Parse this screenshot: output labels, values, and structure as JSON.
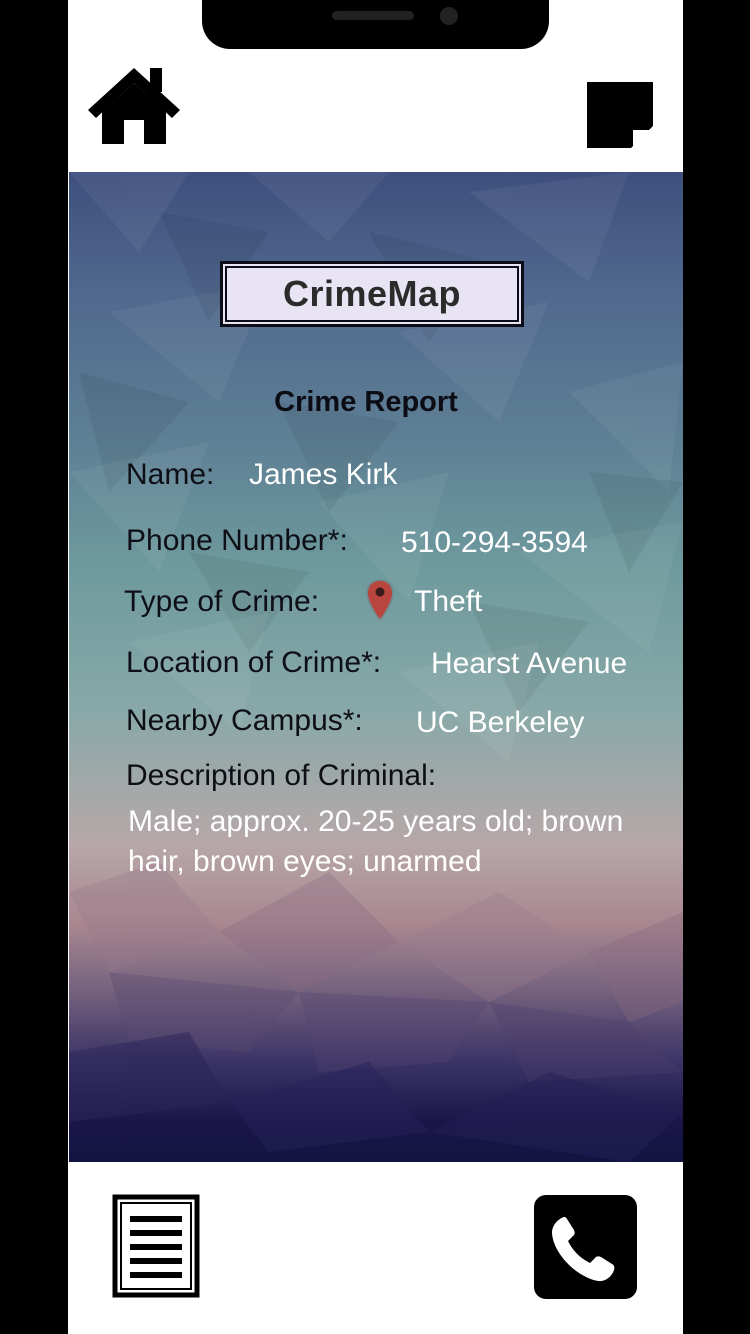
{
  "header": {
    "home_icon": "home-icon",
    "note_icon": "note-icon"
  },
  "app": {
    "title": "CrimeMap"
  },
  "report": {
    "title": "Crime Report",
    "fields": {
      "name": {
        "label": "Name:",
        "value": "James Kirk"
      },
      "phone": {
        "label": "Phone Number*:",
        "value": "510-294-3594"
      },
      "crime_type": {
        "label": "Type of Crime:",
        "value": "Theft",
        "icon": "map-pin-icon"
      },
      "location": {
        "label": "Location of Crime*:",
        "value": "Hearst Avenue"
      },
      "campus": {
        "label": "Nearby Campus*:",
        "value": "UC Berkeley"
      },
      "description": {
        "label": "Description of Criminal:",
        "value": "Male; approx. 20-25 years old; brown hair, brown eyes; unarmed"
      }
    }
  },
  "footer": {
    "list_icon": "document-list-icon",
    "phone_icon": "phone-icon"
  },
  "colors": {
    "pin": "#b8463e",
    "title_box_bg": "#e8e4f4"
  }
}
